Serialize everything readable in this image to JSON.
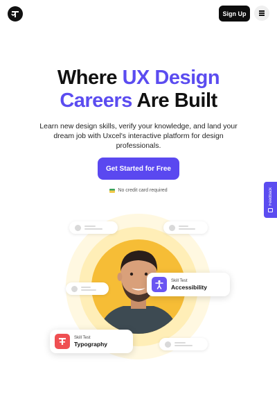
{
  "header": {
    "signup_label": "Sign Up"
  },
  "hero": {
    "headline_line1_plain": "Where ",
    "headline_line1_accent": "UX Design",
    "headline_line2_accent": "Careers",
    "headline_line2_plain": " Are Built",
    "subtitle": "Learn new design skills, verify your knowledge, and land your dream job with Uxcel's interactive platform for design professionals.",
    "cta_label": "Get Started for Free",
    "note": "No credit card required"
  },
  "feedback": {
    "label": "Feedback"
  },
  "cards": [
    {
      "small": "Skill Test",
      "big": "Accessibility",
      "icon": "accessibility-icon",
      "color": "#6a55f2"
    },
    {
      "small": "Skill Test",
      "big": "Typography",
      "icon": "typography-icon",
      "color": "#ef4f52"
    }
  ],
  "colors": {
    "accent": "#5b4cf0",
    "halo": "#ffeeb7",
    "portrait_bg": "#f6bd36"
  }
}
